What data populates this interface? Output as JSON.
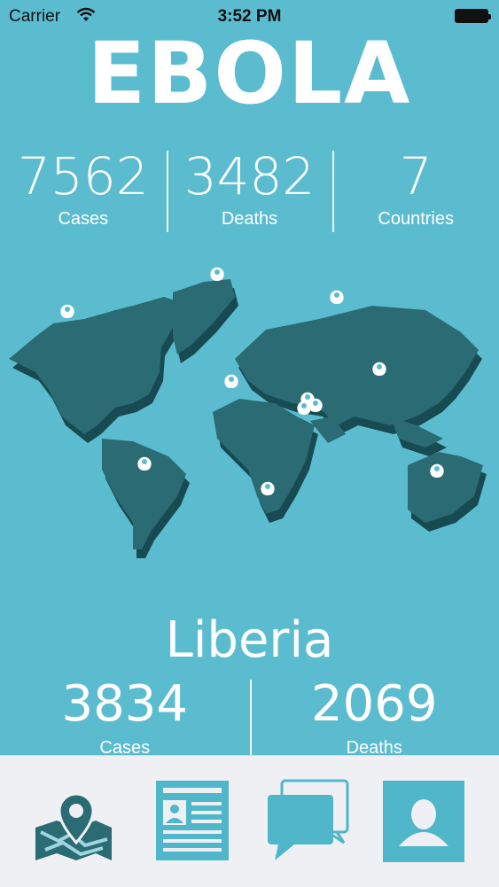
{
  "status_bar": {
    "carrier": "Carrier",
    "time": "3:52 PM"
  },
  "app_title": "EBOLA",
  "global_stats": [
    {
      "value": "7562",
      "label": "Cases"
    },
    {
      "value": "3482",
      "label": "Deaths"
    },
    {
      "value": "7",
      "label": "Countries"
    }
  ],
  "selected_country": {
    "name": "Liberia",
    "stats": [
      {
        "value": "3834",
        "label": "Cases"
      },
      {
        "value": "2069",
        "label": "Deaths"
      }
    ]
  },
  "tab_bar": {
    "tabs": [
      {
        "icon": "map-pin-icon"
      },
      {
        "icon": "news-article-icon"
      },
      {
        "icon": "chat-bubbles-icon"
      },
      {
        "icon": "user-profile-icon"
      }
    ]
  },
  "colors": {
    "background": "#5bbccf",
    "map_land": "#2a6b74",
    "map_shadow": "#184a52",
    "tab_accent": "#4fb7c9",
    "tab_bar_bg": "#eff0f3"
  }
}
